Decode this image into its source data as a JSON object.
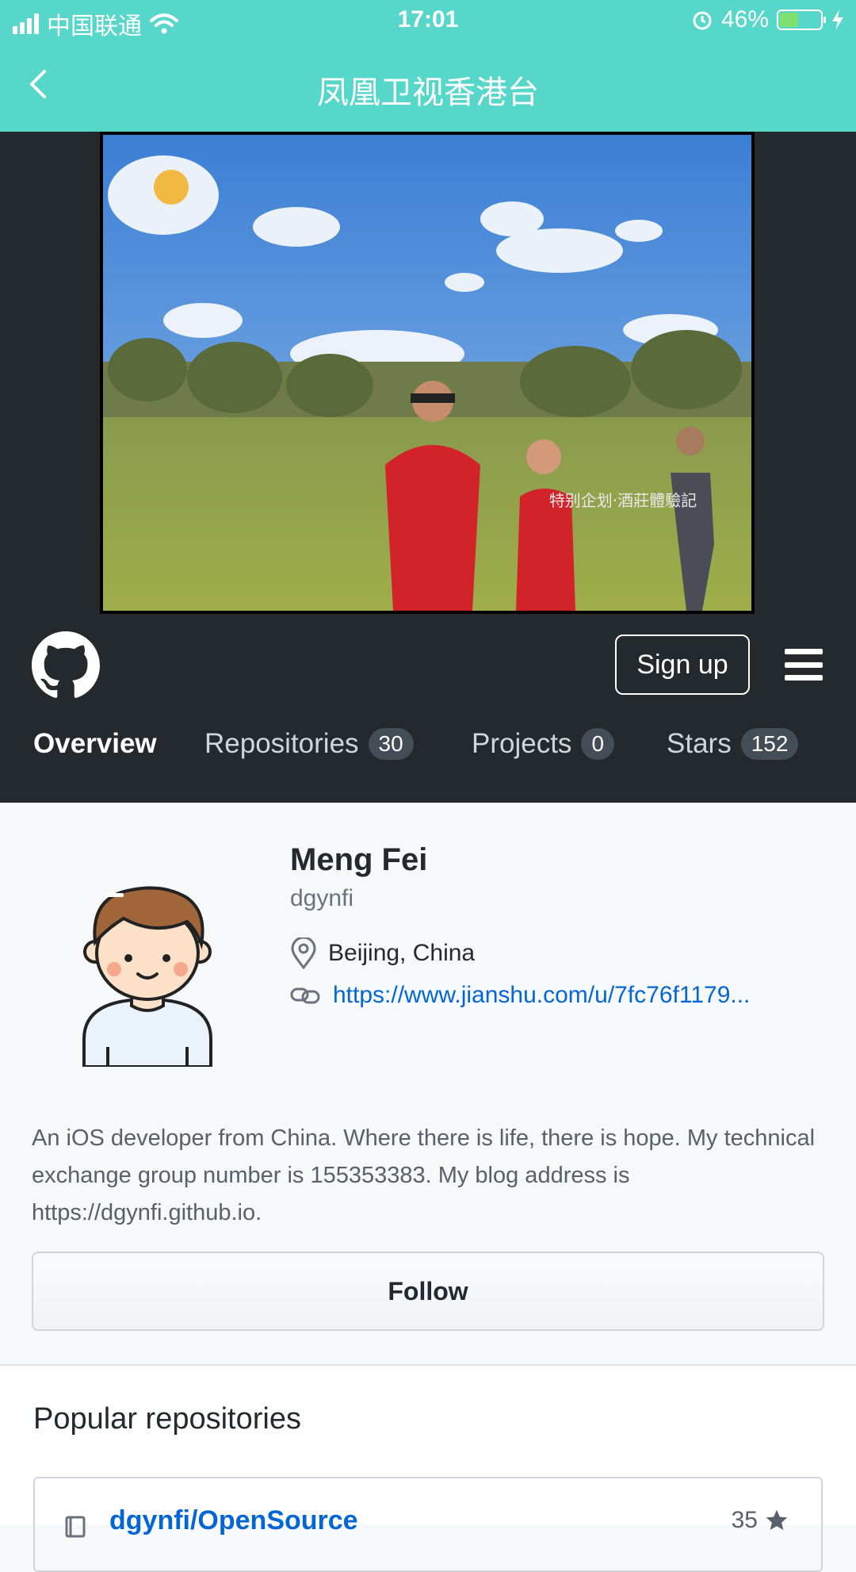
{
  "status_bar": {
    "carrier": "中国联通",
    "time": "17:01",
    "battery": "46%",
    "battery_level": 0.46
  },
  "nav": {
    "title": "凤凰卫视香港台"
  },
  "video": {
    "caption": "特别企划·酒莊體驗記"
  },
  "github": {
    "signup_label": "Sign up",
    "tabs": [
      {
        "label": "Overview"
      },
      {
        "label": "Repositories",
        "count": "30"
      },
      {
        "label": "Projects",
        "count": "0"
      },
      {
        "label": "Stars",
        "count": "152"
      }
    ]
  },
  "profile": {
    "name": "Meng Fei",
    "login": "dgynfi",
    "location": "Beijing, China",
    "url": "https://www.jianshu.com/u/7fc76f1179...",
    "bio": "An iOS developer from China. Where there is life, there is hope. My technical exchange group number is 155353383. My blog address is https://dgynfi.github.io.",
    "follow_label": "Follow"
  },
  "popular": {
    "heading": "Popular repositories",
    "repos": [
      {
        "name": "dgynfi/OpenSource",
        "stars": "35"
      }
    ]
  },
  "colors": {
    "nav_bg": "#56d7ca",
    "github_header": "#24292e",
    "link": "#0366d6"
  }
}
